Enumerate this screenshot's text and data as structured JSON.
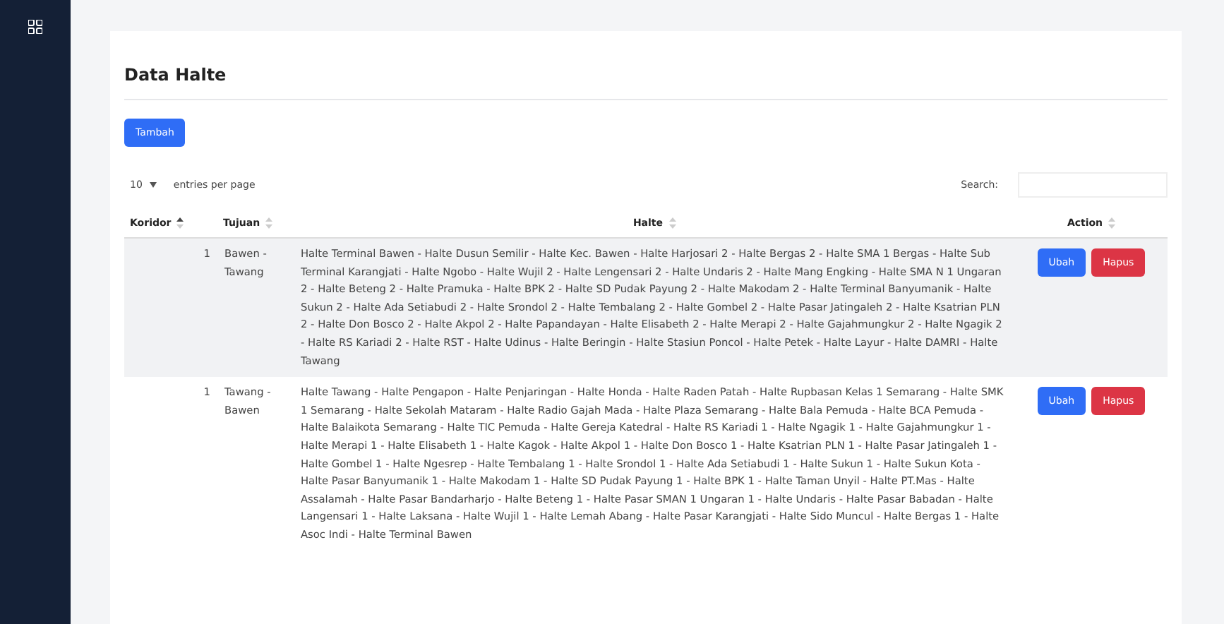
{
  "page": {
    "title": "Data Halte",
    "add_button": "Tambah"
  },
  "table_controls": {
    "page_size": "10",
    "page_size_label": "entries per page",
    "search_label": "Search:"
  },
  "table": {
    "columns": [
      {
        "label": "Koridor",
        "sorted": true
      },
      {
        "label": "Tujuan",
        "sorted": false
      },
      {
        "label": "Halte",
        "sorted": false
      },
      {
        "label": "Action",
        "sorted": false
      }
    ],
    "rows": [
      {
        "koridor": "1",
        "tujuan": "Bawen - Tawang",
        "halte": "Halte Terminal Bawen - Halte Dusun Semilir - Halte Kec. Bawen - Halte Harjosari 2 - Halte Bergas 2 - Halte SMA 1 Bergas - Halte Sub Terminal Karangjati - Halte Ngobo - Halte Wujil 2 - Halte Lengensari 2 - Halte Undaris 2 - Halte Mang Engking - Halte SMA N 1 Ungaran 2 - Halte Beteng 2 - Halte Pramuka - Halte BPK 2 - Halte SD Pudak Payung 2 - Halte Makodam 2 - Halte Terminal Banyumanik - Halte Sukun 2 - Halte Ada Setiabudi 2 - Halte Srondol 2 - Halte Tembalang 2 - Halte Gombel 2 - Halte Pasar Jatingaleh 2 - Halte Ksatrian PLN 2 - Halte Don Bosco 2 - Halte Akpol 2 - Halte Papandayan - Halte Elisabeth 2 - Halte Merapi 2 - Halte Gajahmungkur 2 - Halte Ngagik 2 - Halte RS Kariadi 2 - Halte RST - Halte Udinus - Halte Beringin - Halte Stasiun Poncol - Halte Petek - Halte Layur - Halte DAMRI - Halte Tawang",
        "actions": [
          "Ubah",
          "Hapus"
        ]
      },
      {
        "koridor": "1",
        "tujuan": "Tawang - Bawen",
        "halte": "Halte Tawang - Halte Pengapon - Halte Penjaringan - Halte Honda - Halte Raden Patah - Halte Rupbasan Kelas 1 Semarang - Halte SMK 1 Semarang - Halte Sekolah Mataram - Halte Radio Gajah Mada - Halte Plaza Semarang - Halte Bala Pemuda - Halte BCA Pemuda - Halte Balaikota Semarang - Halte TIC Pemuda - Halte Gereja Katedral - Halte RS Kariadi 1 - Halte Ngagik 1 - Halte Gajahmungkur 1 - Halte Merapi 1 - Halte Elisabeth 1 - Halte Kagok - Halte Akpol 1 - Halte Don Bosco 1 - Halte Ksatrian PLN 1 - Halte Pasar Jatingaleh 1 - Halte Gombel 1 - Halte Ngesrep - Halte Tembalang 1 - Halte Srondol 1 - Halte Ada Setiabudi 1 - Halte Sukun 1 - Halte Sukun Kota - Halte Pasar Banyumanik 1 - Halte Makodam 1 - Halte SD Pudak Payung 1 - Halte BPK 1 - Halte Taman Unyil - Halte PT.Mas - Halte Assalamah - Halte Pasar Bandarharjo - Halte Beteng 1 - Halte Pasar SMAN 1 Ungaran 1 - Halte Undaris - Halte Pasar Babadan - Halte Langensari 1 - Halte Laksana - Halte Wujil 1 - Halte Lemah Abang - Halte Pasar Karangjati - Halte Sido Muncul - Halte Bergas 1 - Halte Asoc Indi - Halte Terminal Bawen",
        "actions": [
          "Ubah",
          "Hapus"
        ]
      }
    ]
  }
}
